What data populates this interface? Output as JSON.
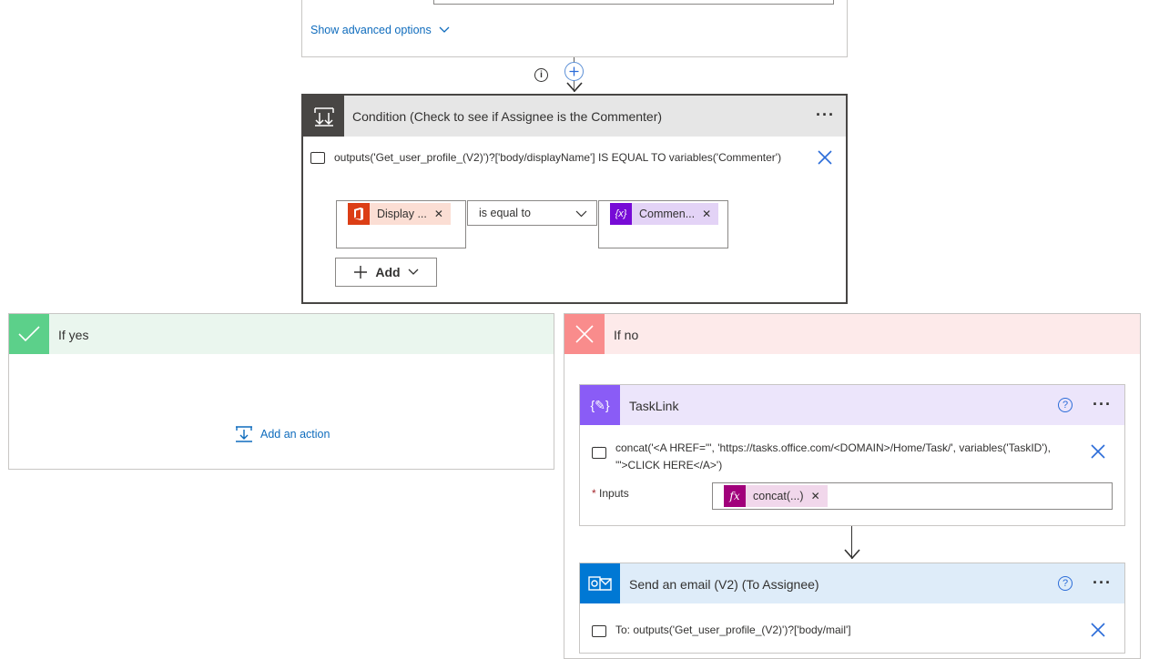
{
  "top_card": {
    "show_advanced": "Show advanced options"
  },
  "condition": {
    "title": "Condition (Check to see if Assignee is the Commenter)",
    "expression": "outputs('Get_user_profile_(V2)')?['body/displayName'] IS EQUAL TO variables('Commenter')",
    "left_token": "Display ...",
    "operator": "is equal to",
    "right_token": "Commen...",
    "right_token_icon": "{x}",
    "add_label": "Add"
  },
  "if_yes": {
    "title": "If yes",
    "add_action": "Add an action"
  },
  "if_no": {
    "title": "If no"
  },
  "tasklink": {
    "title": "TaskLink",
    "expr_line1": "concat('<A HREF=\"', 'https://tasks.office.com/<DOMAIN>/Home/Task/', variables('TaskID'),",
    "expr_line2": "'\">CLICK HERE</A>')",
    "inputs_star": "*",
    "inputs_label": "Inputs",
    "inputs_token": "concat(...)"
  },
  "send_email": {
    "title": "Send an email (V2) (To Assignee)",
    "expr": "To: outputs('Get_user_profile_(V2)')?['body/mail']"
  },
  "colors": {
    "condition_header": "#484644",
    "yes_green": "#5cd08a",
    "yes_bg": "#eaf6ee",
    "no_red": "#f98c8c",
    "no_bg": "#fdeaea",
    "variable_purple": "#770bd6",
    "variable_bg": "#e3d3f6",
    "office_red": "#dc3e15",
    "office_bg": "#fbded4",
    "fx_magenta": "#a1007b",
    "fx_bg": "#f1d7eb",
    "outlook_blue": "#0078d4",
    "outlook_bg": "#deecf9",
    "tasklink_bg": "#ece5fb",
    "tasklink_icon": "#8a5cf6"
  }
}
